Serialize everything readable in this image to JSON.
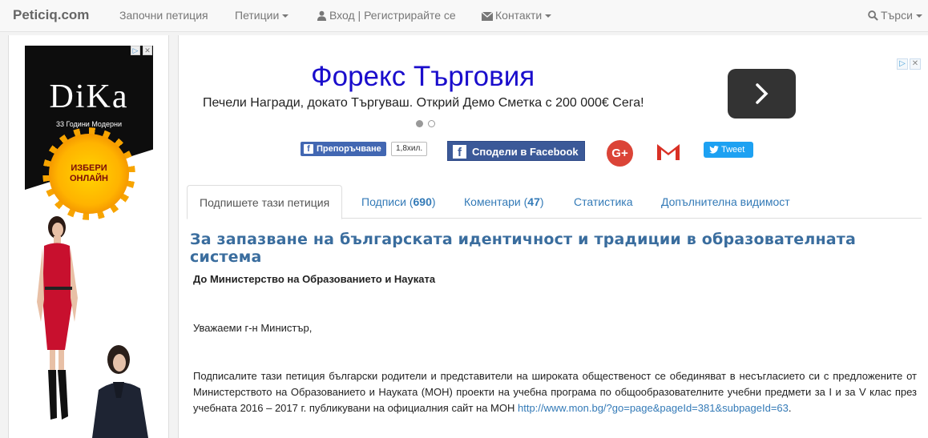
{
  "navbar": {
    "brand": "Peticiq.com",
    "start_petition": "Започни петиция",
    "petitions": "Петиции",
    "login": "Вход | Регистрирайте се",
    "contacts": "Контакти",
    "search": "Търси"
  },
  "left_ad": {
    "logo": "DiKa",
    "subtitle": "33 Години Модерни",
    "cta_line1": "ИЗБЕРИ",
    "cta_line2": "ОНЛАЙН"
  },
  "top_ad": {
    "title": "Форекс Търговия",
    "subtitle": "Печели Награди, докато Търгуваш. Открий Демо Сметка с 200 000€ Сега!"
  },
  "share": {
    "like_label": "Препоръчване",
    "like_count": "1,8хил.",
    "facebook_share": "Сподели в Facebook",
    "gplus": "G+",
    "tweet": "Tweet"
  },
  "tabs": {
    "sign": "Подпишете тази петиция",
    "signatures_label": "Подписи",
    "signatures_count": "690",
    "comments_label": "Коментари",
    "comments_count": "47",
    "stats": "Статистика",
    "visibility": "Допълнителна видимост"
  },
  "petition": {
    "title": "За запазване на българската идентичност и традиции в образователната система",
    "addressee": "До Министерство на Образованието и Науката",
    "greeting": "Уважаеми г-н Министър,",
    "body": "Подписалите тази петиция български родители и представители на широката общественост се обединяват в несъгласието си с предложените от Министерството на Образованието и Науката (МОН) проекти на учебна програма по общообразователните учебни предмети  за I и за V клас през учебната 2016 – 2017 г. публикувани на официалния сайт на МОН ",
    "link": "http://www.mon.bg/?go=page&pageId=381&subpageId=63",
    "body_end": "."
  },
  "colors": {
    "link": "#337ab7",
    "title": "#3a6d9e",
    "facebook": "#3b5998",
    "twitter": "#1da1f2",
    "gplus": "#db4437"
  }
}
